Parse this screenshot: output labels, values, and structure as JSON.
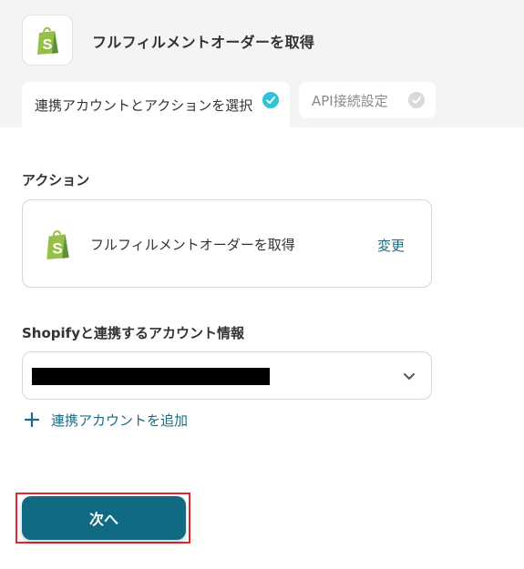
{
  "header": {
    "title": "フルフィルメントオーダーを取得",
    "app_icon": "shopify-bag-icon"
  },
  "tabs": [
    {
      "label": "連携アカウントとアクションを選択",
      "state": "active",
      "icon": "check-circle-icon"
    },
    {
      "label": "API接続設定",
      "state": "inactive",
      "icon": "check-circle-icon"
    }
  ],
  "action_section": {
    "label": "アクション",
    "action_name": "フルフィルメントオーダーを取得",
    "change_label": "変更",
    "icon": "shopify-bag-icon"
  },
  "account_section": {
    "label": "Shopifyと連携するアカウント情報",
    "selected_value_redacted": true,
    "chevron_icon": "chevron-down-icon",
    "add_account_label": "連携アカウントを追加",
    "add_icon": "plus-icon"
  },
  "footer": {
    "next_label": "次へ"
  },
  "colors": {
    "accent": "#0f6a82",
    "link": "#1c6b86",
    "check_active": "#2ec4d6",
    "highlight": "#e0262e",
    "shopify_green": "#95bf47"
  }
}
